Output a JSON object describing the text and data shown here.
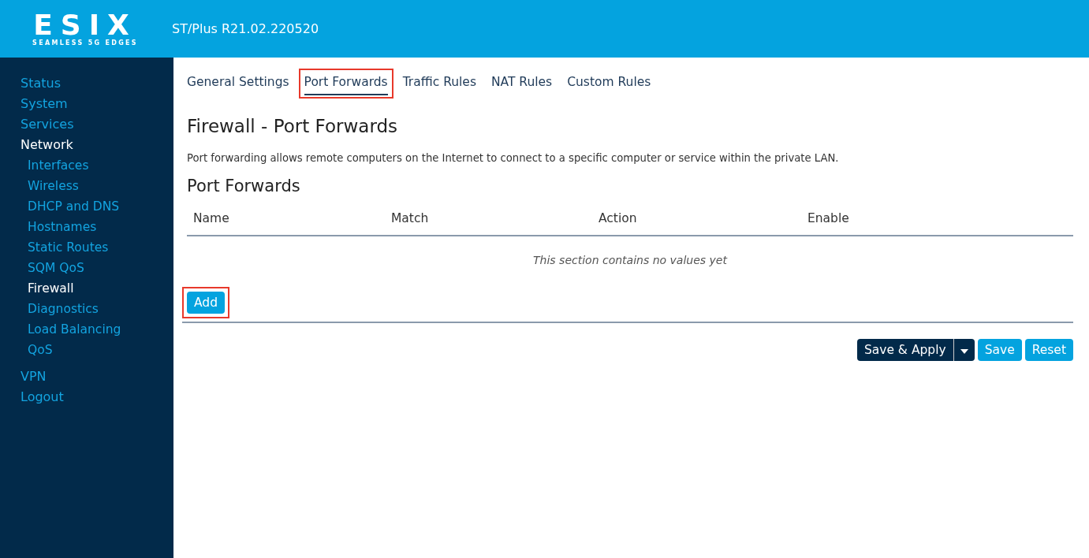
{
  "header": {
    "logo": "ESIX",
    "tagline": "SEAMLESS 5G EDGES",
    "version": "ST/Plus R21.02.220520"
  },
  "sidebar": {
    "items": [
      {
        "label": "Status",
        "selected": false
      },
      {
        "label": "System",
        "selected": false
      },
      {
        "label": "Services",
        "selected": false
      },
      {
        "label": "Network",
        "selected": true,
        "children": [
          {
            "label": "Interfaces",
            "selected": false
          },
          {
            "label": "Wireless",
            "selected": false
          },
          {
            "label": "DHCP and DNS",
            "selected": false
          },
          {
            "label": "Hostnames",
            "selected": false
          },
          {
            "label": "Static Routes",
            "selected": false
          },
          {
            "label": "SQM QoS",
            "selected": false
          },
          {
            "label": "Firewall",
            "selected": true
          },
          {
            "label": "Diagnostics",
            "selected": false
          },
          {
            "label": "Load Balancing",
            "selected": false
          },
          {
            "label": "QoS",
            "selected": false
          }
        ]
      },
      {
        "label": "VPN",
        "selected": false
      },
      {
        "label": "Logout",
        "selected": false
      }
    ]
  },
  "tabs": [
    {
      "label": "General Settings",
      "selected": false,
      "highlighted": false
    },
    {
      "label": "Port Forwards",
      "selected": true,
      "highlighted": true
    },
    {
      "label": "Traffic Rules",
      "selected": false,
      "highlighted": false
    },
    {
      "label": "NAT Rules",
      "selected": false,
      "highlighted": false
    },
    {
      "label": "Custom Rules",
      "selected": false,
      "highlighted": false
    }
  ],
  "page": {
    "title": "Firewall - Port Forwards",
    "description": "Port forwarding allows remote computers on the Internet to connect to a specific computer or service within the private LAN."
  },
  "section": {
    "title": "Port Forwards",
    "table": {
      "columns": [
        "Name",
        "Match",
        "Action",
        "Enable"
      ],
      "empty_message": "This section contains no values yet"
    },
    "add_button": {
      "label": "Add",
      "highlighted": true
    }
  },
  "footer_buttons": [
    {
      "label": "Save & Apply",
      "kind": "split"
    },
    {
      "label": "Save",
      "kind": "plain"
    },
    {
      "label": "Reset",
      "kind": "plain"
    }
  ]
}
